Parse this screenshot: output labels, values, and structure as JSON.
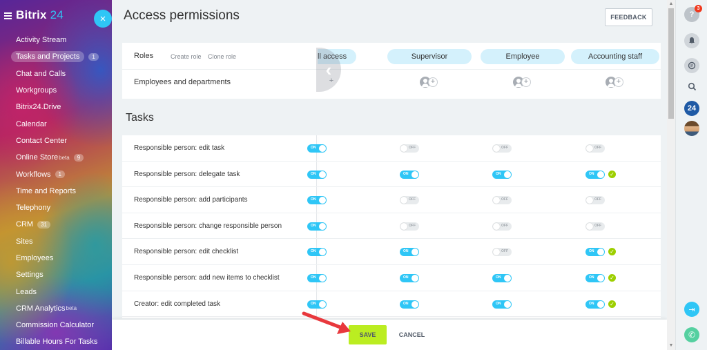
{
  "brand": {
    "name_main": "Bitrix",
    "name_accent": "24"
  },
  "sidebar": {
    "items": [
      {
        "label": "Activity Stream"
      },
      {
        "label": "Tasks and Projects",
        "counter": "1",
        "active": true
      },
      {
        "label": "Chat and Calls"
      },
      {
        "label": "Workgroups"
      },
      {
        "label": "Bitrix24.Drive"
      },
      {
        "label": "Calendar"
      },
      {
        "label": "Contact Center"
      },
      {
        "label": "Online Store",
        "sup": "beta",
        "counter": "9"
      },
      {
        "label": "Workflows",
        "counter": "1"
      },
      {
        "label": "Time and Reports"
      },
      {
        "label": "Telephony"
      },
      {
        "label": "CRM",
        "counter": "31"
      },
      {
        "label": "Sites"
      },
      {
        "label": "Employees"
      },
      {
        "label": "Settings"
      },
      {
        "label": "Leads"
      },
      {
        "label": "CRM Analytics",
        "sup": "beta"
      },
      {
        "label": "Commission Calculator"
      },
      {
        "label": "Billable Hours For Tasks"
      }
    ],
    "close_glyph": "×"
  },
  "page": {
    "title": "Access permissions",
    "feedback": "FEEDBACK"
  },
  "roles": {
    "label": "Roles",
    "create_role": "Create role",
    "clone_role": "Clone role",
    "employees_label": "Employees and departments",
    "columns": [
      "ll access",
      "Supervisor",
      "Employee",
      "Accounting staff"
    ]
  },
  "tasks": {
    "title": "Tasks",
    "on_text": "ON",
    "off_text": "OFF",
    "rows": [
      {
        "label": "Responsible person: edit task",
        "states": [
          true,
          false,
          false,
          false
        ],
        "checks": [
          false,
          false,
          false,
          false
        ]
      },
      {
        "label": "Responsible person: delegate task",
        "states": [
          true,
          true,
          true,
          true
        ],
        "checks": [
          false,
          false,
          false,
          true
        ]
      },
      {
        "label": "Responsible person: add participants",
        "states": [
          true,
          false,
          false,
          false
        ],
        "checks": [
          false,
          false,
          false,
          false
        ]
      },
      {
        "label": "Responsible person: change responsible person",
        "states": [
          true,
          false,
          false,
          false
        ],
        "checks": [
          false,
          false,
          false,
          false
        ]
      },
      {
        "label": "Responsible person: edit checklist",
        "states": [
          true,
          true,
          false,
          true
        ],
        "checks": [
          false,
          false,
          false,
          true
        ]
      },
      {
        "label": "Responsible person: add new items to checklist",
        "states": [
          true,
          true,
          true,
          true
        ],
        "checks": [
          false,
          false,
          false,
          true
        ]
      },
      {
        "label": "Creator: edit completed task",
        "states": [
          true,
          true,
          true,
          true
        ],
        "checks": [
          false,
          false,
          false,
          true
        ]
      }
    ]
  },
  "footer": {
    "save": "SAVE",
    "cancel": "CANCEL"
  },
  "right_panel": {
    "help_badge": "3",
    "portal_label": "24"
  },
  "colors": {
    "accent": "#2fc6f6",
    "save": "#bbed21",
    "check": "#9dcf00",
    "arrow": "#e8383d"
  }
}
